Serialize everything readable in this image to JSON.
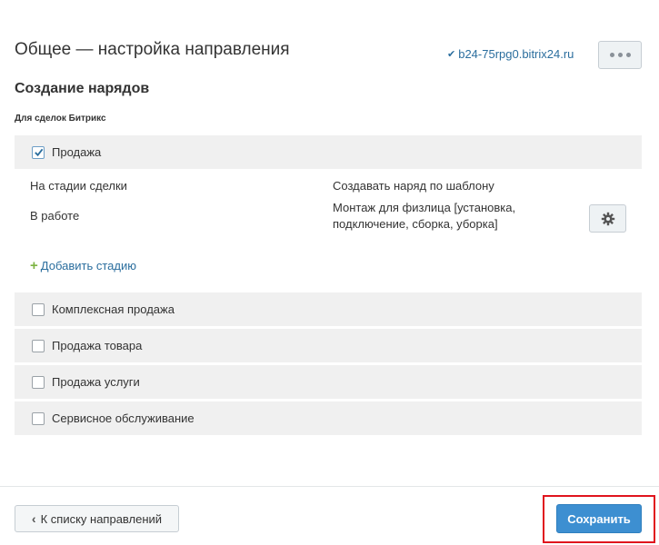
{
  "header": {
    "title": "Общее — настройка направления",
    "portal_link": "b24-75rpg0.bitrix24.ru",
    "more_icon": "ellipsis-icon"
  },
  "section": {
    "title": "Создание нарядов",
    "group_title": "Для сделок Битрикс"
  },
  "directions": [
    {
      "label": "Продажа",
      "checked": true
    },
    {
      "label": "Комплексная продажа",
      "checked": false
    },
    {
      "label": "Продажа товара",
      "checked": false
    },
    {
      "label": "Продажа услуги",
      "checked": false
    },
    {
      "label": "Сервисное обслуживание",
      "checked": false
    }
  ],
  "stages": {
    "col_stage": "На стадии сделки",
    "col_template": "Создавать наряд по шаблону",
    "rows": [
      {
        "stage": "В работе",
        "template_line1": "Монтаж для физлица [установка,",
        "template_line2": "подключение, сборка, уборка]"
      }
    ],
    "add_label": "Добавить стадию",
    "settings_icon": "gear-icon"
  },
  "footer": {
    "back_label": "К списку направлений",
    "save_label": "Сохранить"
  },
  "colors": {
    "accent": "#3d8fd1",
    "link": "#2b6e9e",
    "highlight": "#e0141e",
    "row_bg": "#f0f0f0"
  }
}
